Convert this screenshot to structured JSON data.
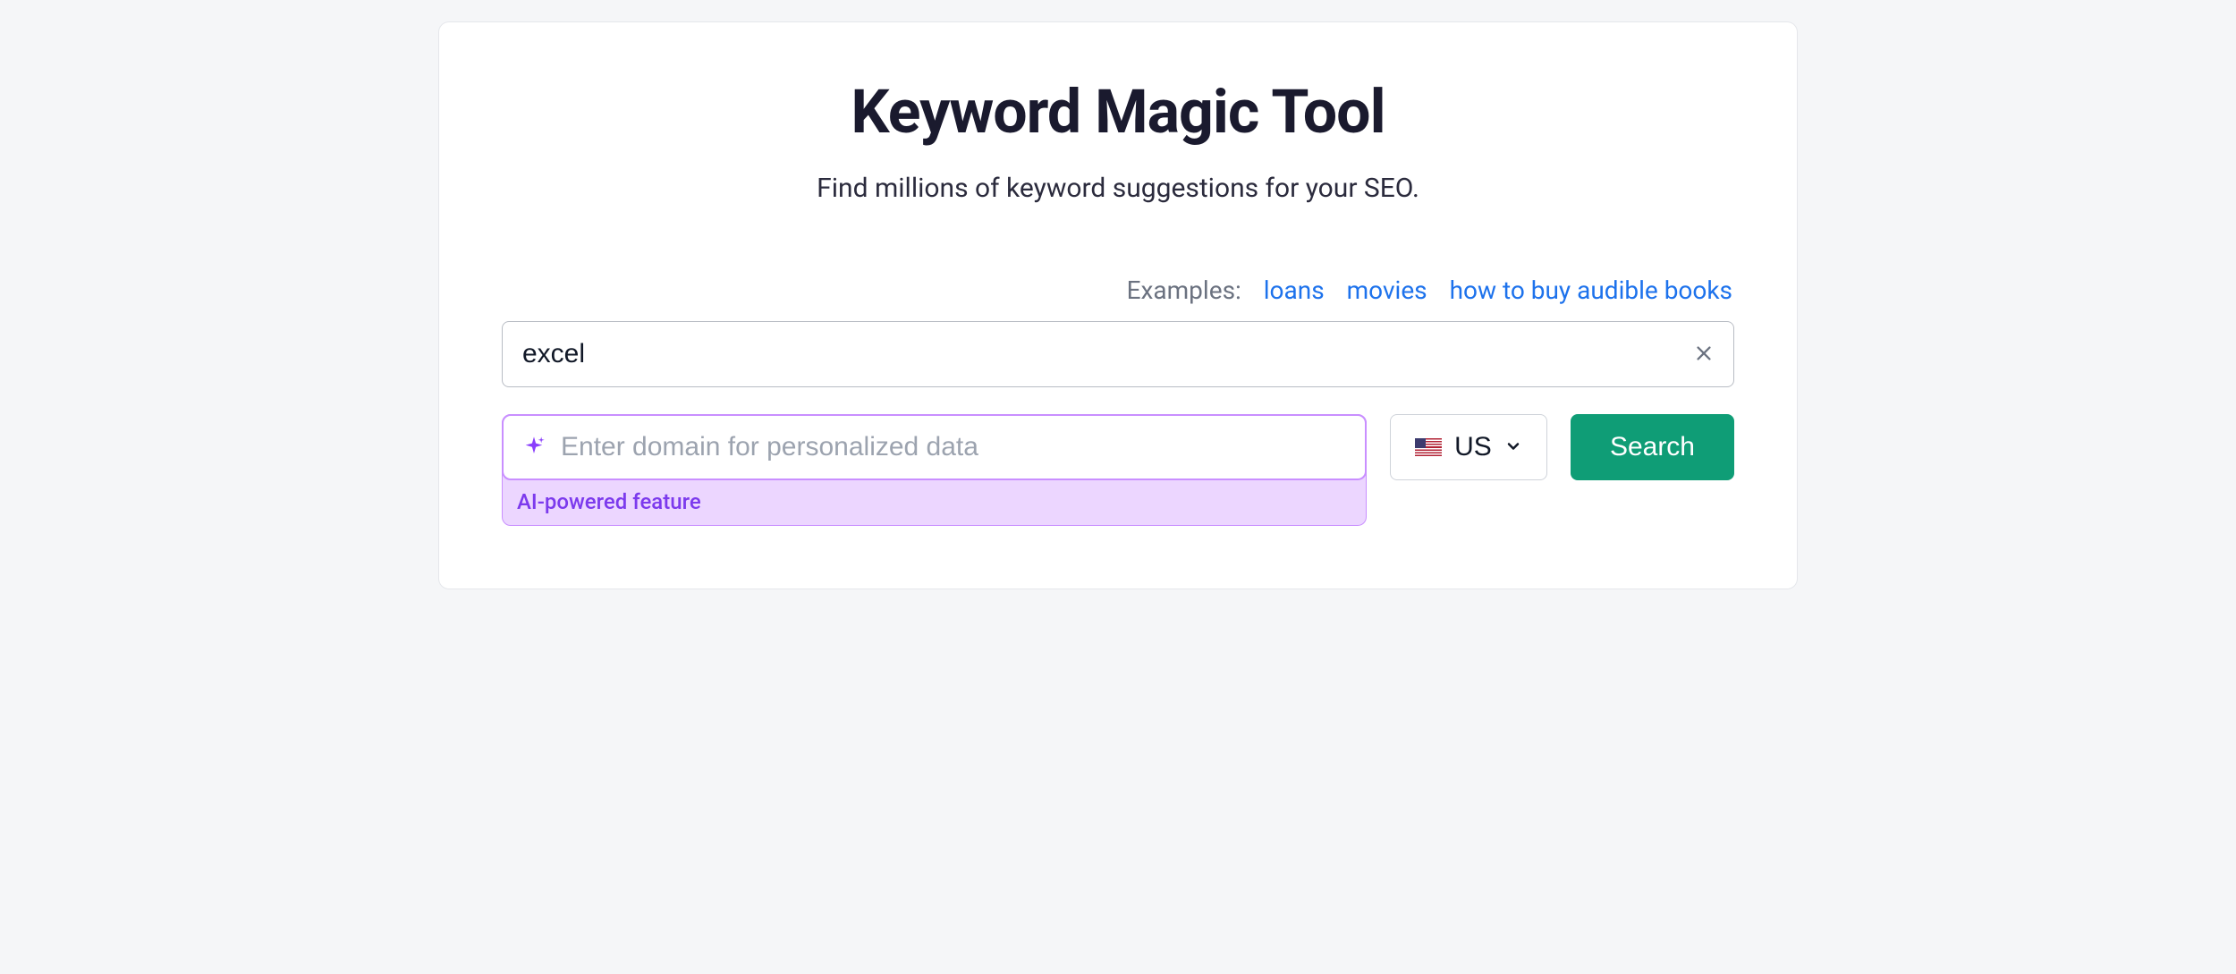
{
  "header": {
    "title": "Keyword Magic Tool",
    "subtitle": "Find millions of keyword suggestions for your SEO."
  },
  "examples": {
    "label": "Examples:",
    "links": [
      "loans",
      "movies",
      "how to buy audible books"
    ]
  },
  "search": {
    "keyword_value": "excel",
    "domain_placeholder": "Enter domain for personalized data",
    "ai_caption": "AI-powered feature",
    "country_code": "US",
    "search_button": "Search"
  }
}
